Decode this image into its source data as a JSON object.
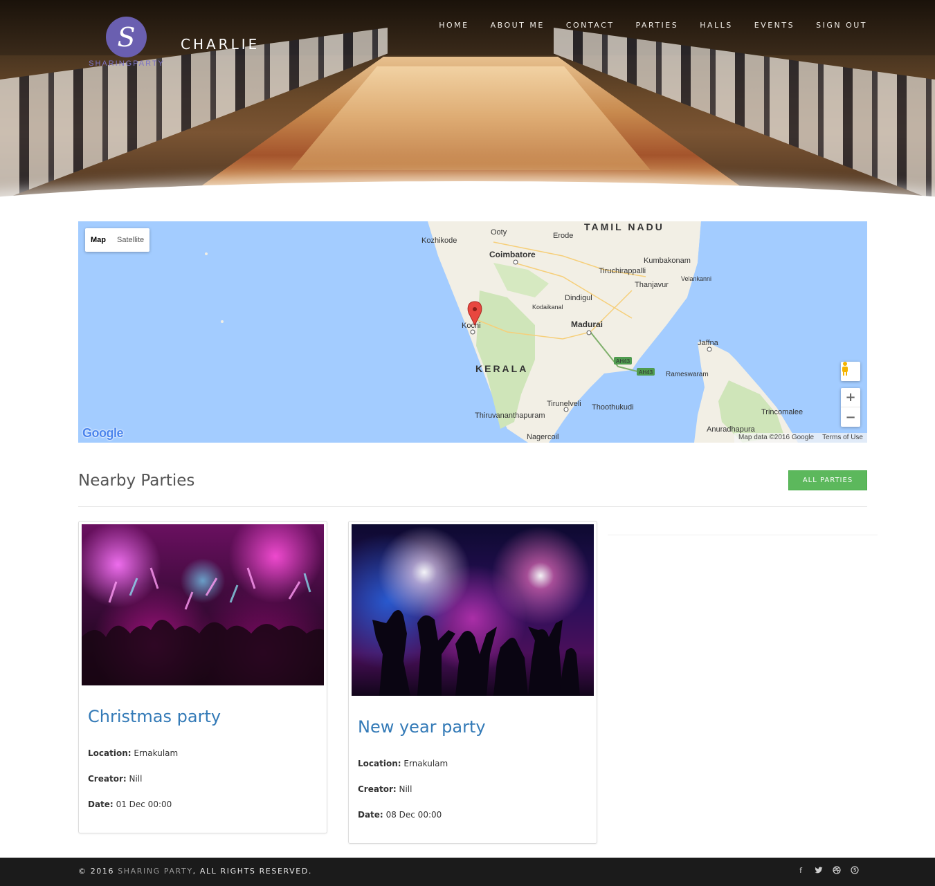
{
  "header": {
    "logo_letter": "S",
    "logo_brand": "SHARINGPARTY",
    "site_title": "CHARLIE",
    "nav": [
      "HOME",
      "ABOUT ME",
      "CONTACT",
      "PARTIES",
      "HALLS",
      "EVENTS",
      "SIGN OUT"
    ]
  },
  "map": {
    "type_controls": [
      "Map",
      "Satellite"
    ],
    "active_type": "Map",
    "labels": {
      "region1": "TAMIL NADU",
      "region2": "KERALA",
      "c1": "Ooty",
      "c2": "Erode",
      "c3": "Kozhikode",
      "c4": "Coimbatore",
      "c5": "Kumbakonam",
      "c6": "Tiruchirappalli",
      "c7": "Thanjavur",
      "c8": "Velankanni",
      "c9": "Dindigul",
      "c10": "Kodaikanal",
      "c11": "Kochi",
      "c12": "Madurai",
      "c13": "Jaffna",
      "c14": "Rameswaram",
      "c15": "Tirunelveli",
      "c16": "Thoothukudi",
      "c17": "Thiruvananthapuram",
      "c18": "Trincomalee",
      "c19": "Anuradhapura",
      "c20": "Nagercoil",
      "h1": "AH43",
      "h2": "AH43"
    },
    "zoom_in": "+",
    "zoom_out": "−",
    "google_logo": "Google",
    "attribution": "Map data ©2016 Google",
    "terms": "Terms of Use"
  },
  "nearby": {
    "title": "Nearby Parties",
    "all_button": "ALL PARTIES",
    "labels": {
      "location": "Location:",
      "creator": "Creator:",
      "date": "Date:"
    },
    "parties": [
      {
        "title": "Christmas party",
        "location": "Ernakulam",
        "creator": "Nill",
        "date": "01 Dec 00:00"
      },
      {
        "title": "New year party",
        "location": "Ernakulam",
        "creator": "Nill",
        "date": "08 Dec 00:00"
      }
    ]
  },
  "footer": {
    "prefix": "© 2016 ",
    "brand": "SHARING PARTY",
    "suffix": ", ALL RIGHTS RESERVED.",
    "social": [
      "facebook-icon",
      "twitter-icon",
      "dribbble-icon",
      "skype-icon"
    ]
  },
  "colors": {
    "accent_green": "#5cb85c",
    "link_blue": "#337ab7",
    "logo_purple": "#6a5fb0",
    "footer_bg": "#1b1b1b",
    "map_water": "#a3ccff"
  }
}
